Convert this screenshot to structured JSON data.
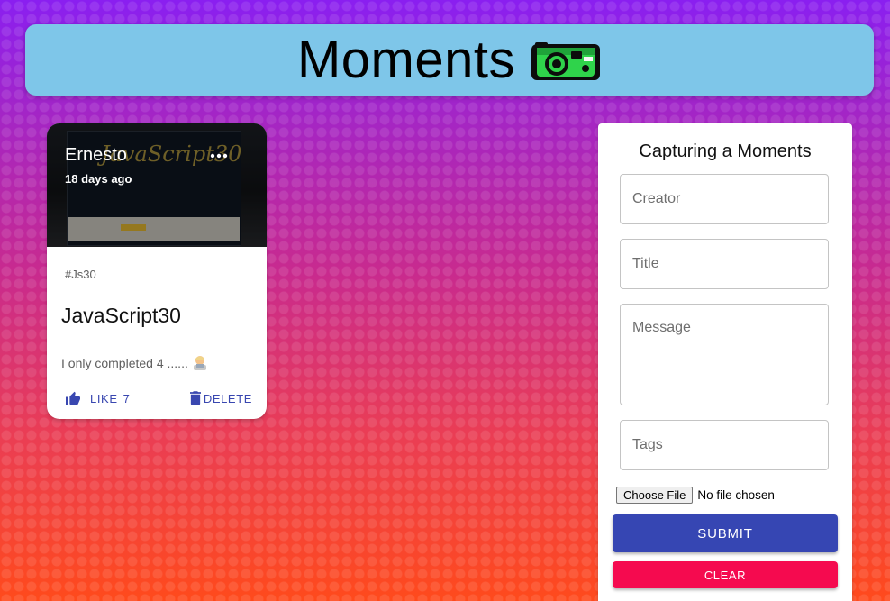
{
  "header": {
    "title": "Moments",
    "logo_icon": "camera-icon",
    "background_color": "#7ec6e9"
  },
  "post": {
    "creator": "Ernesto",
    "time_ago": "18 days ago",
    "more_icon": "more-horiz-icon",
    "tags": "#Js30",
    "title": "JavaScript30",
    "message": "I only completed 4 ......",
    "message_emoji": "man-technologist-emoji",
    "like_icon": "thumb-up-icon",
    "like_label": "LIKE",
    "like_count": "7",
    "delete_icon": "trash-icon",
    "delete_label": "DELETE",
    "media_watermark": "JavaScript30"
  },
  "form": {
    "title": "Capturing a Moments",
    "creator_placeholder": "Creator",
    "title_placeholder": "Title",
    "message_placeholder": "Message",
    "tags_placeholder": "Tags",
    "file_button_label": "Choose File",
    "file_status": "No file chosen",
    "submit_label": "SUBMIT",
    "clear_label": "CLEAR"
  },
  "colors": {
    "accent_primary": "#3646b3",
    "accent_secondary": "#f50a4f",
    "background_top": "#8a1ff0",
    "background_bottom": "#ff4a1c"
  }
}
